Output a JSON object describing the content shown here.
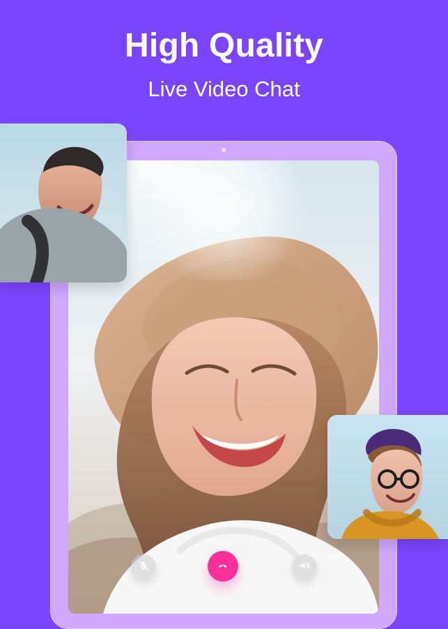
{
  "header": {
    "title": "High Quality",
    "subtitle": "Live Video Chat"
  },
  "icons": {
    "mic_off": "mic-off-icon",
    "hangup": "hangup-icon",
    "speaker": "speaker-icon"
  },
  "colors": {
    "background": "#7b45ff",
    "device_frame": "#cfa7ff",
    "hangup": "#ff2f9b"
  }
}
